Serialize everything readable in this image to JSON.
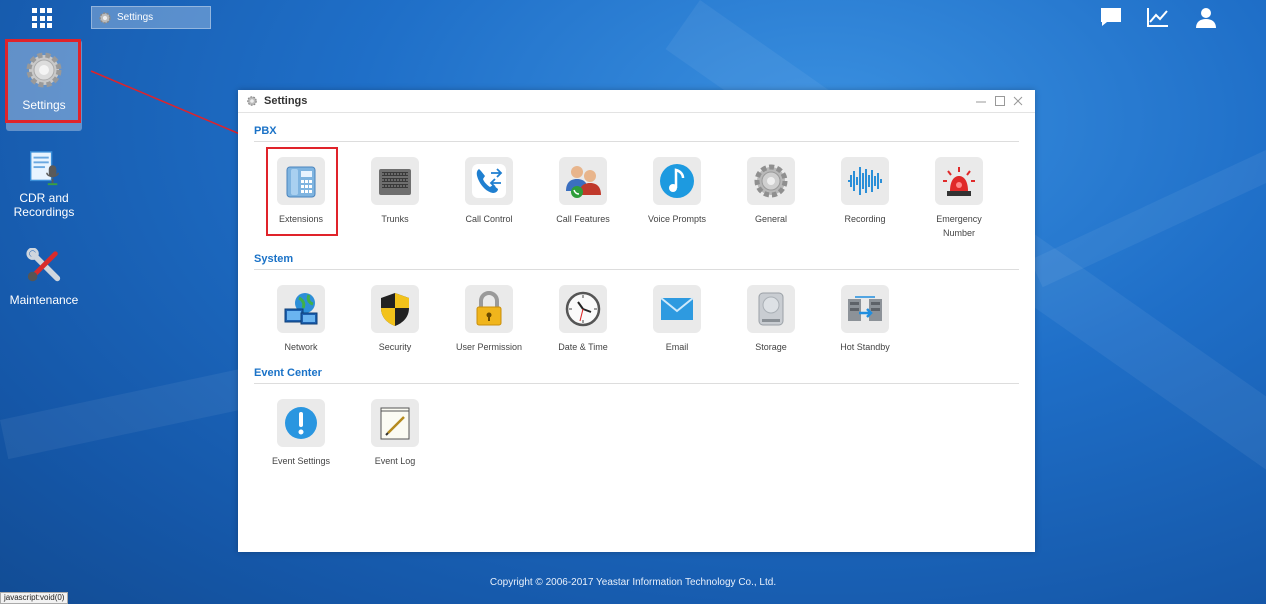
{
  "taskbar": {
    "settings_tab": "Settings"
  },
  "desktop": {
    "items": [
      {
        "label": "Settings"
      },
      {
        "label_line1": "CDR and",
        "label_line2": "Recordings"
      },
      {
        "label": "Maintenance"
      }
    ]
  },
  "window": {
    "title": "Settings",
    "sections": {
      "pbx": {
        "title": "PBX",
        "items": [
          "Extensions",
          "Trunks",
          "Call Control",
          "Call Features",
          "Voice Prompts",
          "General",
          "Recording"
        ],
        "emergency_line1": "Emergency",
        "emergency_line2": "Number"
      },
      "system": {
        "title": "System",
        "items": [
          "Network",
          "Security",
          "User Permission",
          "Date & Time",
          "Email",
          "Storage",
          "Hot Standby"
        ]
      },
      "event": {
        "title": "Event Center",
        "items": [
          "Event Settings",
          "Event Log"
        ]
      }
    }
  },
  "footer": {
    "copyright": "Copyright © 2006-2017 Yeastar Information Technology Co., Ltd."
  },
  "status": {
    "text": "javascript:void(0)"
  },
  "colors": {
    "accent": "#1a72c7",
    "highlight": "#e0232a",
    "background": "#1f6fc8"
  }
}
